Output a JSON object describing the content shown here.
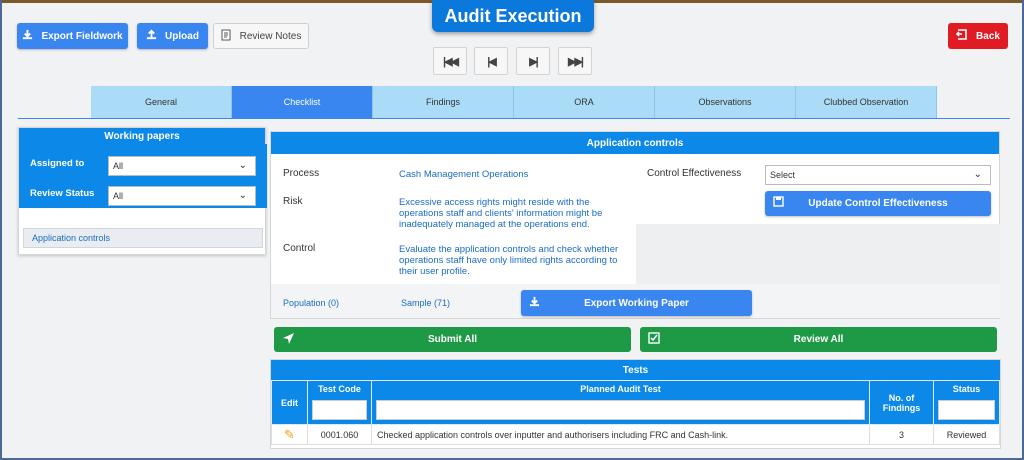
{
  "header": {
    "title": "Audit Execution",
    "export_fieldwork": "Export Fieldwork",
    "upload": "Upload",
    "review_notes": "Review Notes",
    "back": "Back"
  },
  "tabs": [
    {
      "label": "General"
    },
    {
      "label": "Checklist"
    },
    {
      "label": "Findings"
    },
    {
      "label": "ORA"
    },
    {
      "label": "Observations"
    },
    {
      "label": "Clubbed Observation"
    }
  ],
  "working_papers": {
    "title": "Working papers",
    "assigned_to_label": "Assigned to",
    "assigned_to_value": "All",
    "review_status_label": "Review Status",
    "review_status_value": "All",
    "item": "Application controls"
  },
  "application_controls": {
    "title": "Application controls",
    "process_label": "Process",
    "process_value": "Cash Management Operations",
    "risk_label": "Risk",
    "risk_value": "Excessive access rights might reside with the operations staff and clients' information might be inadequately managed at the operations end.",
    "control_label": "Control",
    "control_value": "Evaluate the application controls and check whether operations staff have only limited rights according to their user profile.",
    "effectiveness_label": "Control Effectiveness",
    "effectiveness_value": "Select",
    "update_button": "Update Control Effectiveness",
    "population": "Population (0)",
    "sample": "Sample (71)",
    "export_wp": "Export Working Paper"
  },
  "actions": {
    "submit_all": "Submit All",
    "review_all": "Review All"
  },
  "tests": {
    "title": "Tests",
    "columns": {
      "edit": "Edit",
      "test_code": "Test Code",
      "planned": "Planned Audit Test",
      "findings": "No. of Findings",
      "status": "Status"
    },
    "rows": [
      {
        "code": "0001.060",
        "test": "Checked application controls over inputter and authorisers including FRC and Cash-link.",
        "findings": "3",
        "status": "Reviewed"
      }
    ]
  },
  "colors": {
    "primary": "#0b88e8",
    "accent": "#3a86f0",
    "back": "#e01b24",
    "success": "#1e9a46"
  }
}
